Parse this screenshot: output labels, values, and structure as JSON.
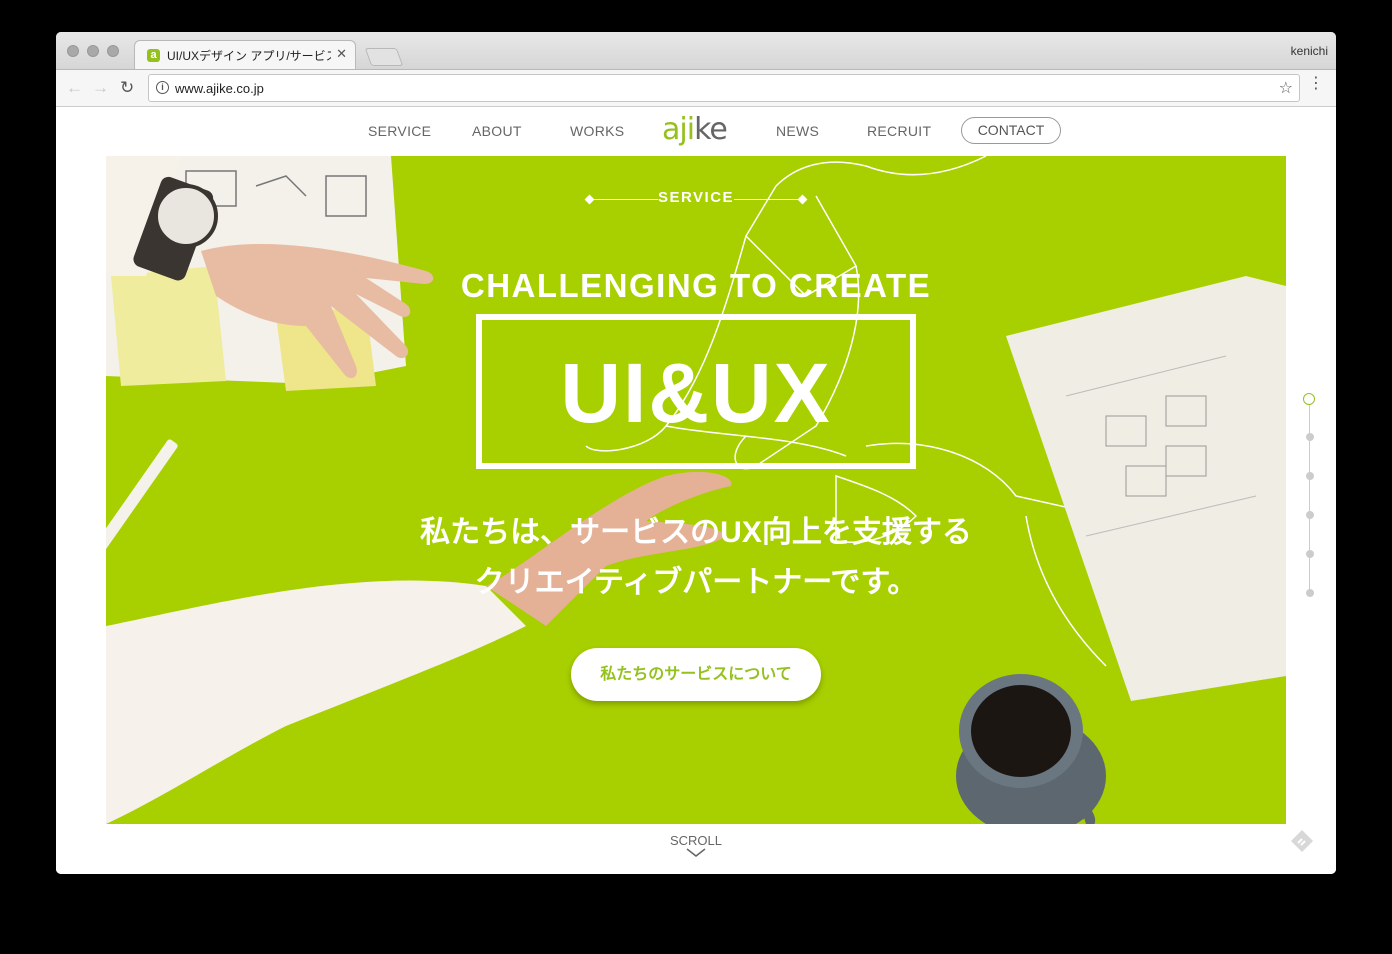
{
  "browser": {
    "tab_title": "UI/UXデザイン アプリ/サービス開",
    "favicon_letter": "a",
    "close_label": "✕",
    "profile_name": "kenichi",
    "url": "www.ajike.co.jp",
    "back_icon": "←",
    "forward_icon": "→",
    "reload_icon": "↻",
    "star_icon": "☆",
    "menu_icon": "⋮"
  },
  "nav": {
    "items": [
      "SERVICE",
      "ABOUT",
      "WORKS",
      "NEWS",
      "RECRUIT"
    ],
    "logo_green": "aji",
    "logo_gray": "ke",
    "contact_label": "CONTACT"
  },
  "hero": {
    "eyebrow": "SERVICE",
    "tagline": "CHALLENGING TO CREATE",
    "title": "UI&UX",
    "lead_line1": "私たちは、サービスのUX向上を支援する",
    "lead_line2": "クリエイティブパートナーです。",
    "cta_label": "私たちのサービスについて",
    "background_color": "#a8cf00",
    "accent_color": "#95c11f"
  },
  "pager": {
    "count": 6,
    "active_index": 0
  },
  "scroll": {
    "label": "SCROLL"
  }
}
